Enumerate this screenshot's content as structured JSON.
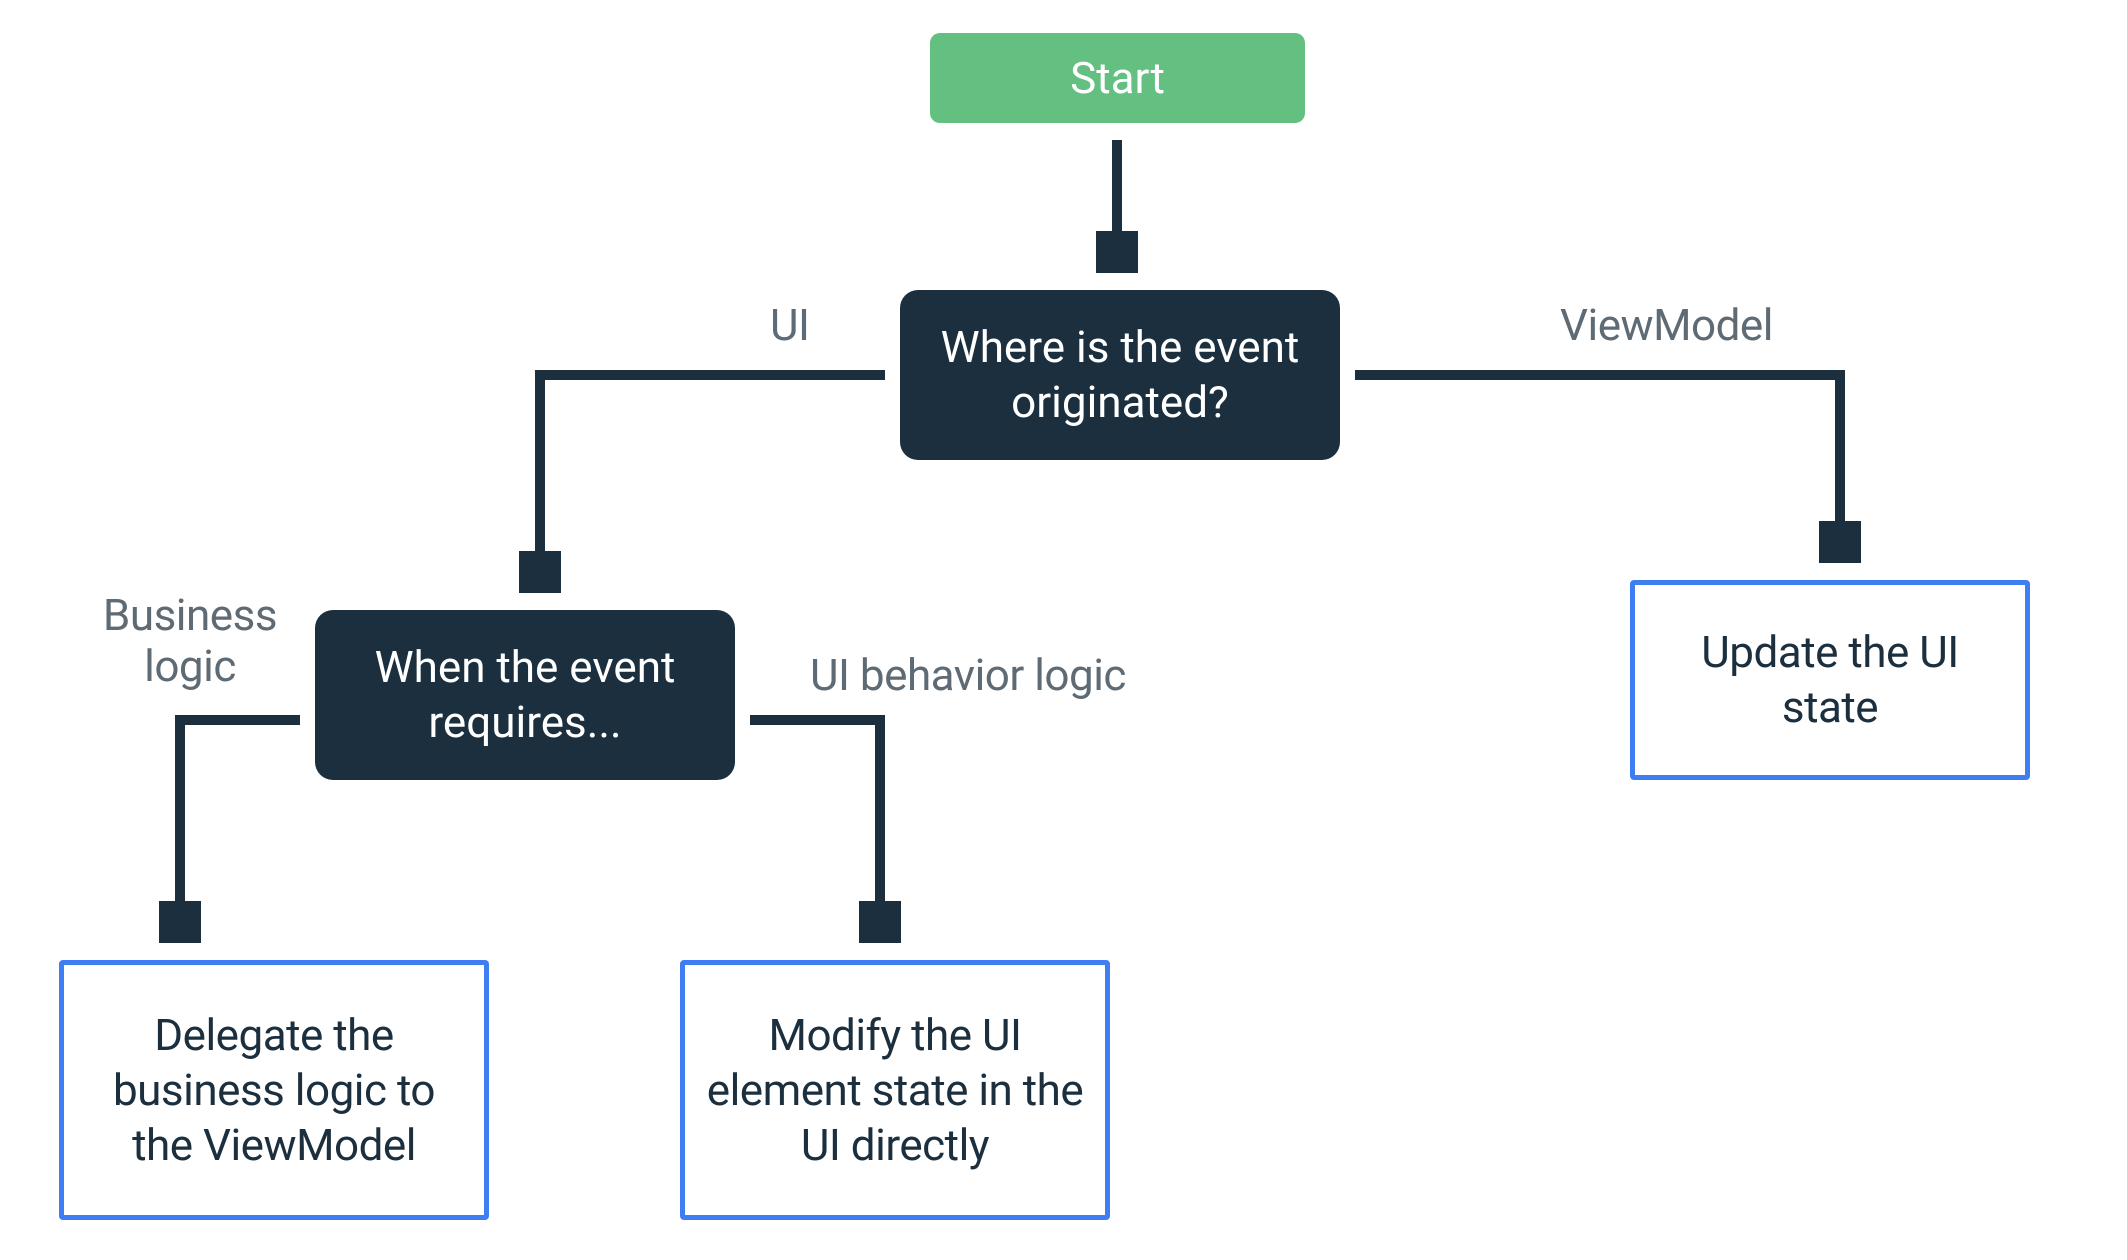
{
  "nodes": {
    "start": "Start",
    "decision1": "Where is the event originated?",
    "decision2": "When the event requires...",
    "result_update": "Update the UI state",
    "result_modify": "Modify the UI element state in the UI directly",
    "result_delegate": "Delegate the business logic to the ViewModel"
  },
  "edges": {
    "ui": "UI",
    "viewmodel": "ViewModel",
    "business_logic": "Business logic",
    "ui_behavior_logic": "UI behavior logic"
  },
  "colors": {
    "start_bg": "#64c080",
    "decision_bg": "#1b2f3e",
    "result_border": "#3f7ef2",
    "edge_label": "#5e6b75",
    "arrow": "#1b2f3e"
  }
}
